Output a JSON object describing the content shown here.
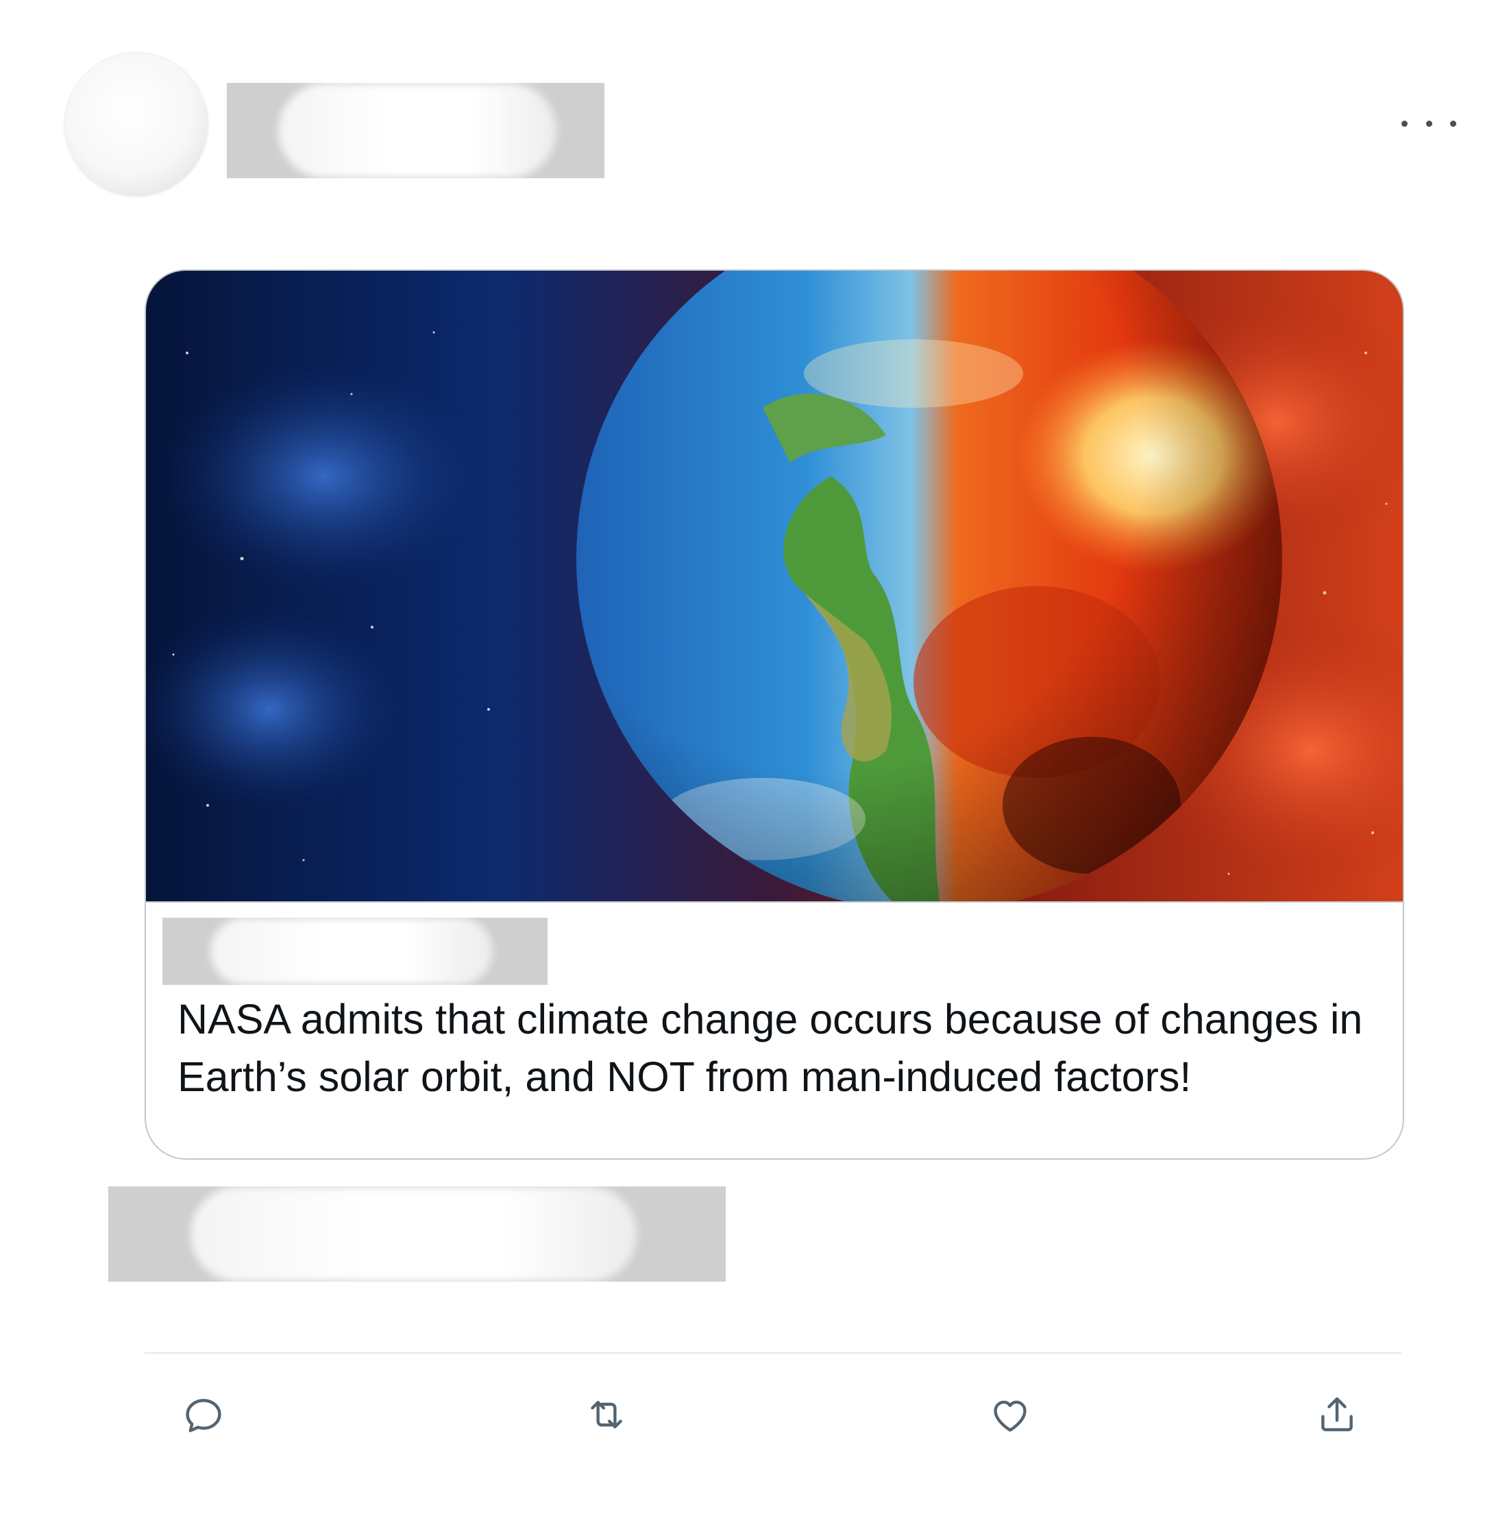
{
  "tweet": {
    "menu_icon": "more-horizontal-icon",
    "card": {
      "image_description_icon": "earth-half-burning-image",
      "title": "NASA admits that climate change occurs because of changes in Earth’s solar orbit, and NOT from man-induced factors!"
    },
    "actions": [
      {
        "icon": "reply-icon"
      },
      {
        "icon": "retweet-icon"
      },
      {
        "icon": "like-icon"
      },
      {
        "icon": "share-icon"
      }
    ]
  },
  "colors": {
    "text": "#0f1419",
    "icon": "#536471",
    "border": "#c4c8cc",
    "redaction": "#cfcfcf"
  }
}
